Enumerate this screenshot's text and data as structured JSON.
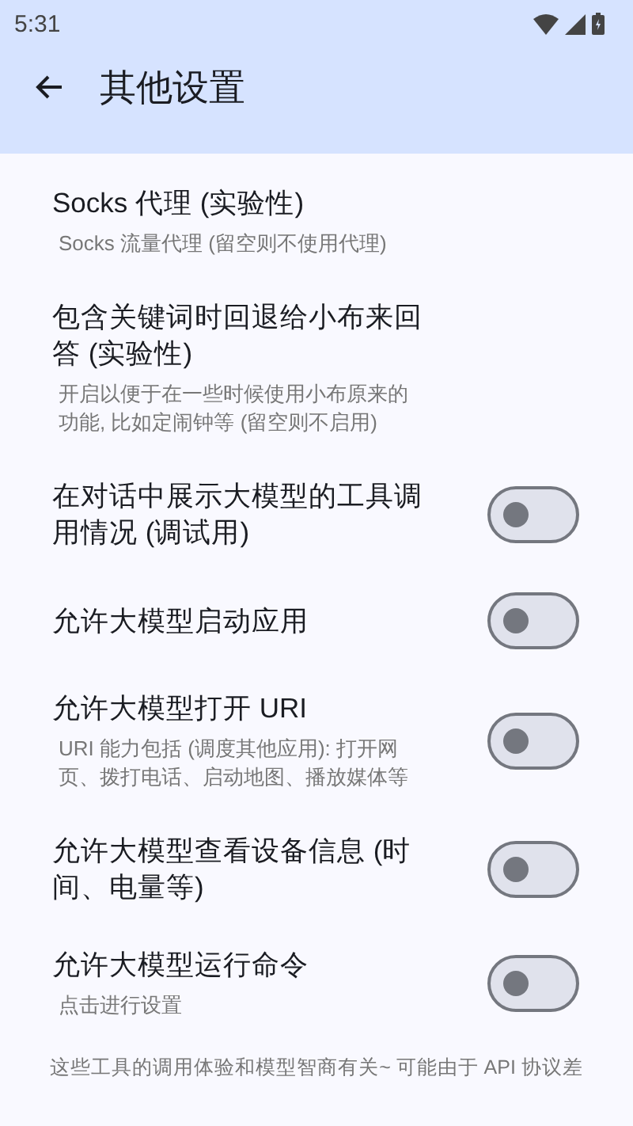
{
  "status_bar": {
    "time": "5:31"
  },
  "app_bar": {
    "title": "其他设置"
  },
  "settings": [
    {
      "kind": "text",
      "title": "Socks 代理 (实验性)",
      "subtitle": "Socks 流量代理 (留空则不使用代理)"
    },
    {
      "kind": "text",
      "title": "包含关键词时回退给小布来回答 (实验性)",
      "subtitle": "开启以便于在一些时候使用小布原来的功能, 比如定闹钟等 (留空则不启用)"
    },
    {
      "kind": "switch",
      "title": "在对话中展示大模型的工具调用情况 (调试用)",
      "on": false
    },
    {
      "kind": "switch",
      "title": "允许大模型启动应用",
      "on": false
    },
    {
      "kind": "switch",
      "title": "允许大模型打开 URI",
      "subtitle": "URI 能力包括 (调度其他应用): 打开网页、拨打电话、启动地图、播放媒体等",
      "on": false
    },
    {
      "kind": "switch",
      "title": "允许大模型查看设备信息 (时间、电量等)",
      "on": false
    },
    {
      "kind": "switch",
      "title": "允许大模型运行命令",
      "subtitle": "点击进行设置",
      "on": false
    }
  ],
  "footer": "这些工具的调用体验和模型智商有关~ 可能由于 API 协议差"
}
